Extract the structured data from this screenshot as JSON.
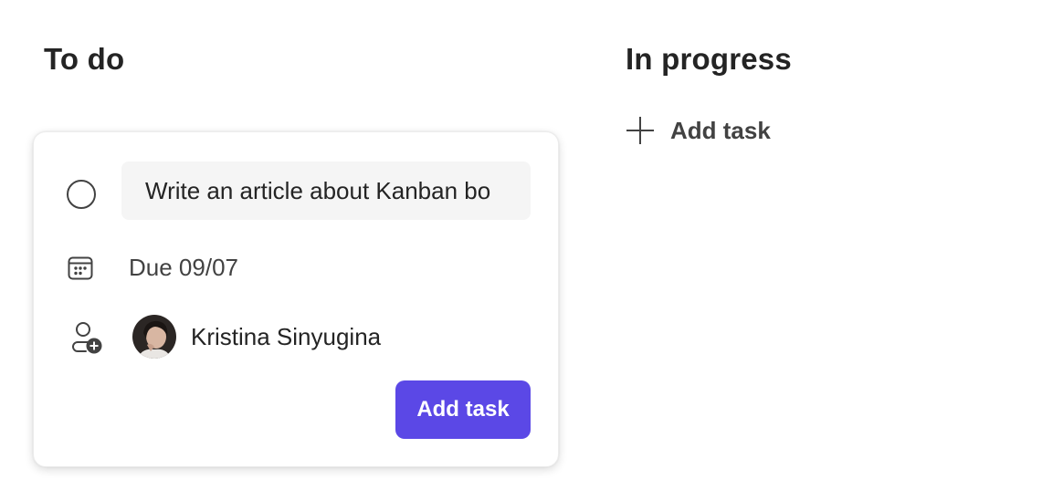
{
  "columns": [
    {
      "title": "To do"
    },
    {
      "title": "In progress",
      "add_task_label": "Add task"
    }
  ],
  "new_task_card": {
    "title_value": "Write an article about Kanban bo",
    "due_text": "Due 09/07",
    "assignee": {
      "name": "Kristina Sinyugina"
    },
    "submit_label": "Add task"
  },
  "colors": {
    "accent": "#5b48e6",
    "text_primary": "#242424",
    "text_secondary": "#424242",
    "input_background": "#f5f5f5"
  },
  "icons": {
    "plus": "plus-icon",
    "calendar": "calendar-icon",
    "assign": "person-add-icon",
    "complete": "circle-icon"
  }
}
